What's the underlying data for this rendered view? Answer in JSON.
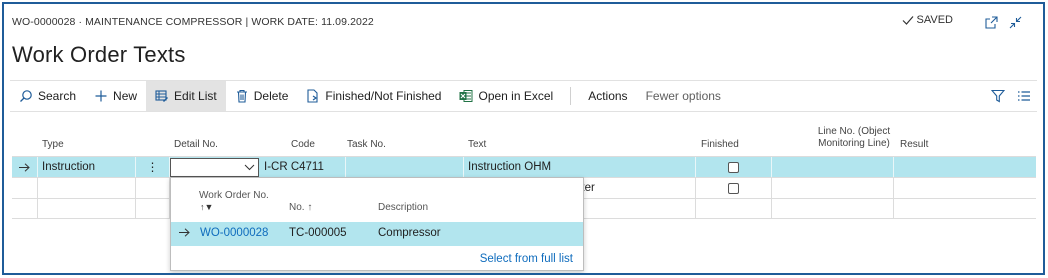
{
  "header": {
    "breadcrumb": "WO-0000028 · MAINTENANCE COMPRESSOR | WORK DATE: 11.09.2022",
    "saved_label": "SAVED"
  },
  "page": {
    "title": "Work Order Texts"
  },
  "actions": {
    "search": "Search",
    "new": "New",
    "edit_list": "Edit List",
    "delete": "Delete",
    "finished_toggle": "Finished/Not Finished",
    "open_excel": "Open in Excel",
    "actions": "Actions",
    "fewer_options": "Fewer options"
  },
  "grid": {
    "columns": {
      "type": "Type",
      "detail_no": "Detail No.",
      "code": "Code",
      "task_no": "Task No.",
      "text": "Text",
      "finished": "Finished",
      "line_no": "Line No. (Object Monitoring Line)",
      "result": "Result"
    },
    "rows": [
      {
        "type": "Instruction",
        "detail_no": "",
        "code": "I-CR C4711",
        "task_no": "",
        "text": "Instruction OHM",
        "finished": false
      },
      {
        "type": "",
        "detail_no": "",
        "code": "",
        "task_no": "",
        "text": "eter",
        "finished": false
      },
      {
        "type": "",
        "detail_no": "",
        "code": "",
        "task_no": "",
        "text": "",
        "finished": null
      }
    ]
  },
  "lookup": {
    "columns": {
      "work_order_no": "Work Order No.",
      "no": "No. ↑",
      "description": "Description"
    },
    "rows": [
      {
        "work_order_no": "WO-0000028",
        "no": "TC-000005",
        "description": "Compressor"
      }
    ],
    "full_list_link": "Select from full list"
  },
  "colors": {
    "selected_row": "#b2e5ee",
    "frame_border": "#1f5c99",
    "link": "#0f6cbd"
  },
  "icons": [
    "check-icon",
    "popout-icon",
    "collapse-icon",
    "search-icon",
    "plus-icon",
    "edit-list-icon",
    "trash-icon",
    "finished-icon",
    "excel-icon",
    "filter-icon",
    "list-icon",
    "arrow-right-icon",
    "ellipsis-icon",
    "chevron-down-icon",
    "sort-filter-icon"
  ]
}
